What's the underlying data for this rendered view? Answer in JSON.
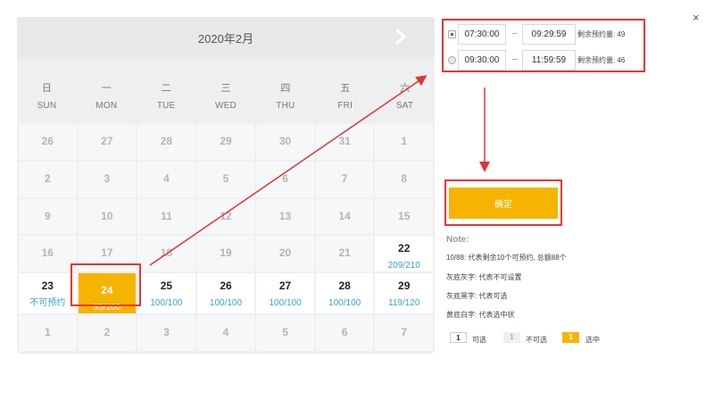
{
  "calendar": {
    "title": "2020年2月",
    "weekdays": [
      {
        "zh": "日",
        "en": "SUN"
      },
      {
        "zh": "一",
        "en": "MON"
      },
      {
        "zh": "二",
        "en": "TUE"
      },
      {
        "zh": "三",
        "en": "WED"
      },
      {
        "zh": "四",
        "en": "THU"
      },
      {
        "zh": "五",
        "en": "FRI"
      },
      {
        "zh": "六",
        "en": "SAT"
      }
    ],
    "days": [
      {
        "n": "26",
        "state": "disabled",
        "sub": ""
      },
      {
        "n": "27",
        "state": "disabled",
        "sub": ""
      },
      {
        "n": "28",
        "state": "disabled",
        "sub": ""
      },
      {
        "n": "29",
        "state": "disabled",
        "sub": ""
      },
      {
        "n": "30",
        "state": "disabled",
        "sub": ""
      },
      {
        "n": "31",
        "state": "disabled",
        "sub": ""
      },
      {
        "n": "1",
        "state": "disabled",
        "sub": ""
      },
      {
        "n": "2",
        "state": "disabled",
        "sub": ""
      },
      {
        "n": "3",
        "state": "disabled",
        "sub": ""
      },
      {
        "n": "4",
        "state": "disabled",
        "sub": ""
      },
      {
        "n": "5",
        "state": "disabled",
        "sub": ""
      },
      {
        "n": "6",
        "state": "disabled",
        "sub": ""
      },
      {
        "n": "7",
        "state": "disabled",
        "sub": ""
      },
      {
        "n": "8",
        "state": "disabled",
        "sub": ""
      },
      {
        "n": "9",
        "state": "disabled",
        "sub": ""
      },
      {
        "n": "10",
        "state": "disabled",
        "sub": ""
      },
      {
        "n": "11",
        "state": "disabled",
        "sub": ""
      },
      {
        "n": "12",
        "state": "disabled",
        "sub": ""
      },
      {
        "n": "13",
        "state": "disabled",
        "sub": ""
      },
      {
        "n": "14",
        "state": "disabled",
        "sub": ""
      },
      {
        "n": "15",
        "state": "disabled",
        "sub": ""
      },
      {
        "n": "16",
        "state": "disabled",
        "sub": ""
      },
      {
        "n": "17",
        "state": "disabled",
        "sub": ""
      },
      {
        "n": "18",
        "state": "disabled",
        "sub": ""
      },
      {
        "n": "19",
        "state": "disabled",
        "sub": ""
      },
      {
        "n": "20",
        "state": "disabled",
        "sub": ""
      },
      {
        "n": "21",
        "state": "disabled",
        "sub": ""
      },
      {
        "n": "22",
        "state": "available",
        "sub": "209/210"
      },
      {
        "n": "23",
        "state": "available",
        "sub": "不可预约"
      },
      {
        "n": "24",
        "state": "selected",
        "sub": "95/100"
      },
      {
        "n": "25",
        "state": "available",
        "sub": "100/100"
      },
      {
        "n": "26",
        "state": "available",
        "sub": "100/100"
      },
      {
        "n": "27",
        "state": "available",
        "sub": "100/100"
      },
      {
        "n": "28",
        "state": "available",
        "sub": "100/100"
      },
      {
        "n": "29",
        "state": "available",
        "sub": "119/120"
      },
      {
        "n": "1",
        "state": "disabled",
        "sub": ""
      },
      {
        "n": "2",
        "state": "disabled",
        "sub": ""
      },
      {
        "n": "3",
        "state": "disabled",
        "sub": ""
      },
      {
        "n": "4",
        "state": "disabled",
        "sub": ""
      },
      {
        "n": "5",
        "state": "disabled",
        "sub": ""
      },
      {
        "n": "6",
        "state": "disabled",
        "sub": ""
      },
      {
        "n": "7",
        "state": "disabled",
        "sub": ""
      }
    ]
  },
  "slots": [
    {
      "start": "07:30:00",
      "sep": "--",
      "end": "09:29:59",
      "remaining": "剩余预约量: 49",
      "checked": true
    },
    {
      "start": "09:30:00",
      "sep": "--",
      "end": "11:59:59",
      "remaining": "剩余预约量: 46",
      "checked": false
    }
  ],
  "confirm_label": "确定",
  "close_label": "×",
  "note": {
    "title": "Note:",
    "lines": [
      "10/88: 代表剩余10个可预约, 总额88个",
      "灰底灰字: 代表不可设置",
      "灰底黑字: 代表可选",
      "黄底白字: 代表选中状"
    ]
  },
  "legend": [
    {
      "box": "1",
      "label": "可选"
    },
    {
      "box": "1",
      "label": "不可选"
    },
    {
      "box": "1",
      "label": "选中"
    }
  ],
  "colors": {
    "accent": "#f5b400",
    "annotation": "#e33333",
    "link": "#3aa0d4"
  },
  "icons": {
    "next": "chevron-right-icon",
    "close": "close-icon"
  }
}
